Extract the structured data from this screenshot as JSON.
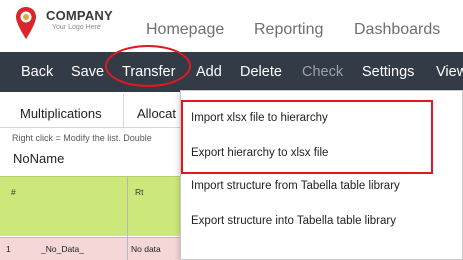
{
  "brand": {
    "name": "COMPANY",
    "tagline": "Your Logo Here"
  },
  "top_nav": [
    "Homepage",
    "Reporting",
    "Dashboards"
  ],
  "toolbar": {
    "back": "Back",
    "save": "Save",
    "transfer": "Transfer",
    "add": "Add",
    "delete": "Delete",
    "check": "Check",
    "settings": "Settings",
    "view": "View"
  },
  "tabs": [
    "Multiplications",
    "Allocat"
  ],
  "hint": "Right click = Modify the list. Double",
  "sheet_name": "NoName",
  "grid": {
    "headers": [
      "#",
      "Rt"
    ],
    "rows": [
      {
        "num": "1",
        "name": "_No_Data_",
        "rt": "No data"
      }
    ]
  },
  "transfer_menu": [
    "Import xlsx file to hierarchy",
    "Export hierarchy to xlsx file",
    "Import structure from Tabella table library",
    "Export structure into Tabella table library"
  ],
  "colors": {
    "toolbar_bg": "#333b47",
    "annotation_red": "#e01820",
    "logo_red": "#d9262c",
    "grid_header": "#cde87a"
  }
}
